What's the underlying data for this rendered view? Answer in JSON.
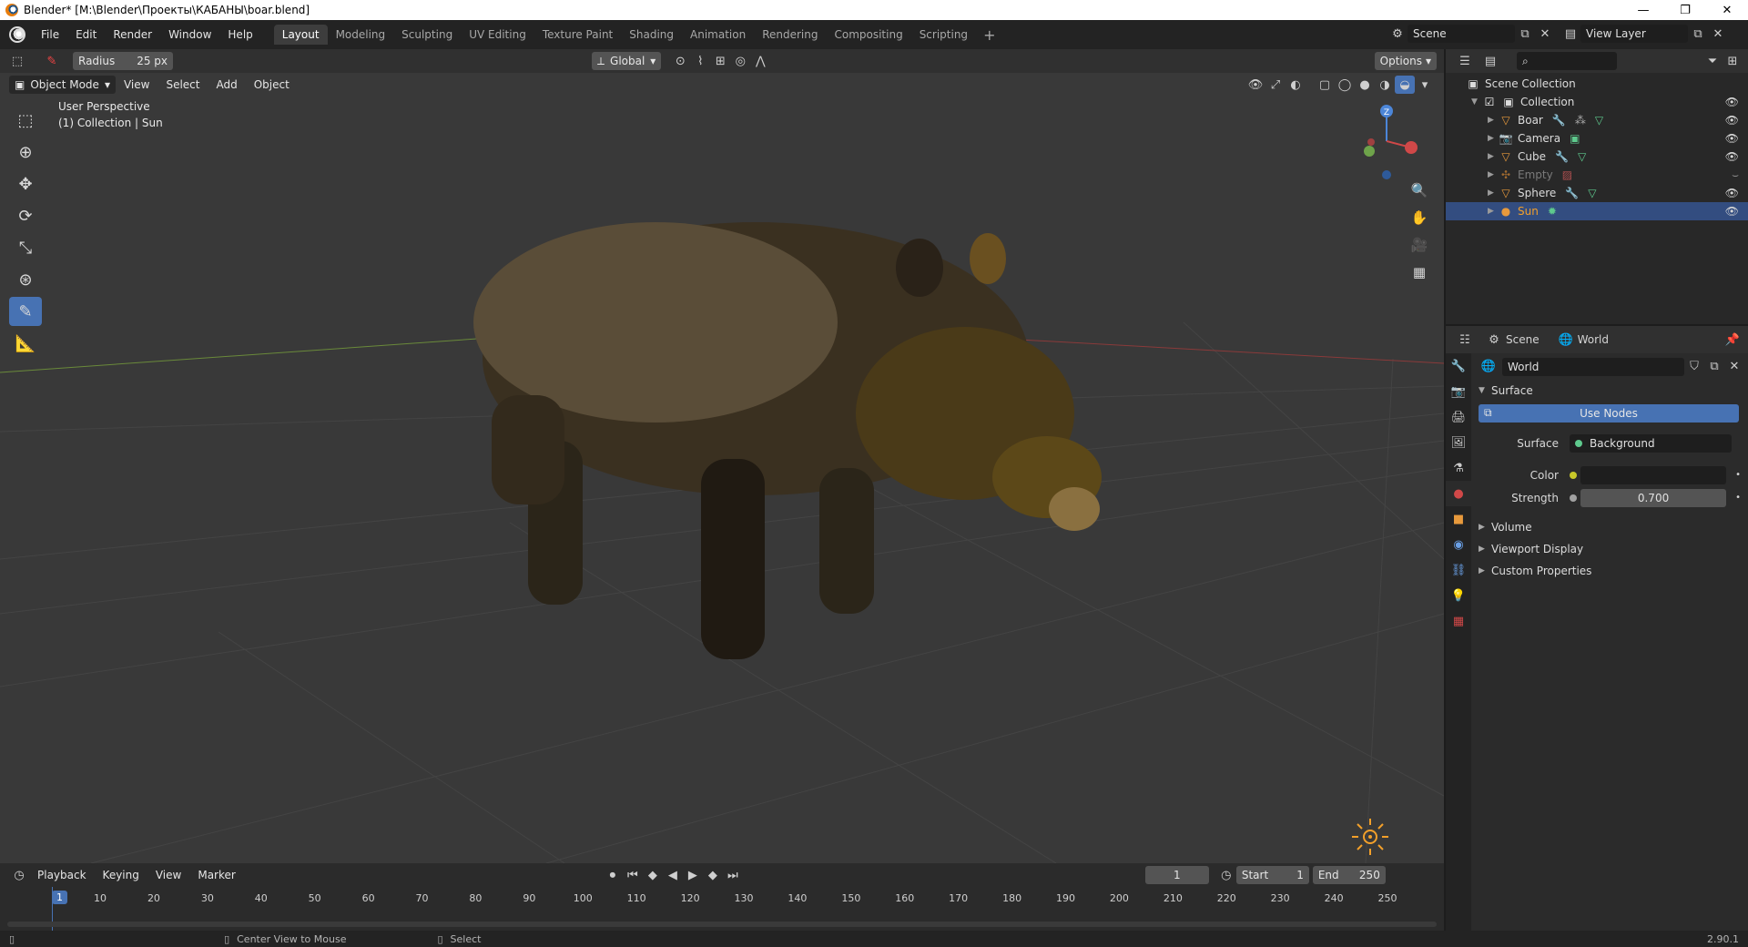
{
  "window": {
    "title": "Blender* [M:\\Blender\\Проекты\\КАБАНЫ\\boar.blend]",
    "minimize": "—",
    "maximize": "❐",
    "close": "✕"
  },
  "menu": {
    "items": [
      "File",
      "Edit",
      "Render",
      "Window",
      "Help"
    ],
    "workspaces": [
      "Layout",
      "Modeling",
      "Sculpting",
      "UV Editing",
      "Texture Paint",
      "Shading",
      "Animation",
      "Rendering",
      "Compositing",
      "Scripting"
    ],
    "active_workspace": "Layout",
    "add_workspace": "+",
    "scene": "Scene",
    "view_layer": "View Layer"
  },
  "viewport": {
    "tool_settings": {
      "radius_label": "Radius",
      "radius_value": "25 px",
      "orientation": "Global",
      "options": "Options"
    },
    "mode": "Object Mode",
    "header_menus": [
      "View",
      "Select",
      "Add",
      "Object"
    ],
    "info_line1": "User Perspective",
    "info_line2": "(1) Collection | Sun",
    "gizmo_z": "Z"
  },
  "timeline": {
    "menus": [
      "Playback",
      "Keying",
      "View",
      "Marker"
    ],
    "current_frame": "1",
    "start_label": "Start",
    "start_value": "1",
    "end_label": "End",
    "end_value": "250",
    "ticks": [
      "1",
      "10",
      "20",
      "30",
      "40",
      "50",
      "60",
      "70",
      "80",
      "90",
      "100",
      "110",
      "120",
      "130",
      "140",
      "150",
      "160",
      "170",
      "180",
      "190",
      "200",
      "210",
      "220",
      "230",
      "240",
      "250"
    ]
  },
  "statusbar": {
    "hint1": "Center View to Mouse",
    "hint2": "Select",
    "version": "2.90.1"
  },
  "outliner": {
    "root": "Scene Collection",
    "collection": "Collection",
    "objects": [
      {
        "name": "Boar",
        "type": "mesh"
      },
      {
        "name": "Camera",
        "type": "camera"
      },
      {
        "name": "Cube",
        "type": "mesh"
      },
      {
        "name": "Empty",
        "type": "empty"
      },
      {
        "name": "Sphere",
        "type": "mesh"
      },
      {
        "name": "Sun",
        "type": "light"
      }
    ],
    "selected": "Sun"
  },
  "properties": {
    "breadcrumb_scene": "Scene",
    "breadcrumb_world": "World",
    "world_name": "World",
    "surface_panel": "Surface",
    "use_nodes": "Use Nodes",
    "surface_label": "Surface",
    "surface_value": "Background",
    "color_label": "Color",
    "strength_label": "Strength",
    "strength_value": "0.700",
    "collapsed_panels": [
      "Volume",
      "Viewport Display",
      "Custom Properties"
    ]
  },
  "colors": {
    "accent": "#4772b3",
    "selected_row": "#334d80",
    "viewport_bg": "#393939",
    "mesh_icon": "#e89a3c"
  }
}
